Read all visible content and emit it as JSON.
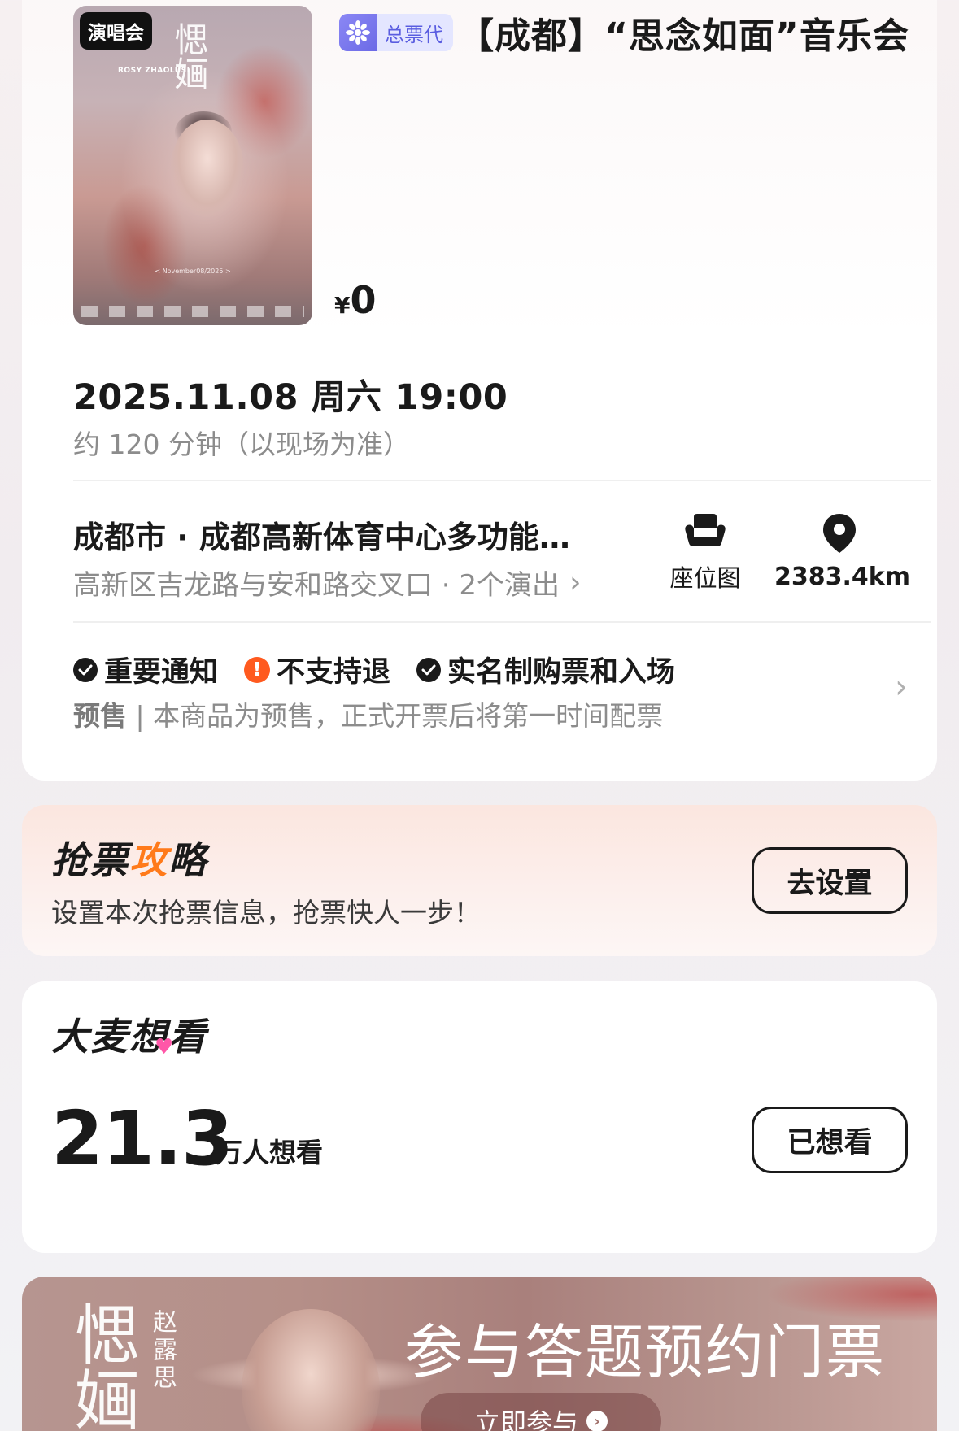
{
  "event": {
    "category_tag": "演唱会",
    "agent_badge": "总票代",
    "title": "【成都】“思念如面”音乐会",
    "price_symbol": "¥",
    "price": "0",
    "datetime": "2025.11.08 周六 19:00",
    "duration": "约 120 分钟（以现场为准）",
    "venue_name": "成都市 · 成都高新体育中心多功能…",
    "venue_address": "高新区吉龙路与安和路交叉口 · 2个演出",
    "seat_map_label": "座位图",
    "distance": "2383.4km",
    "notices": [
      "重要通知",
      "不支持退",
      "实名制购票和入场"
    ],
    "presale_label": "预售",
    "presale_text": "| 本商品为预售，正式开票后将第一时间配票",
    "poster": {
      "callig": "愢婳",
      "small": "ROSY ZHAOLUSI",
      "date": "< November08/2025 >"
    }
  },
  "strategy": {
    "title_a": "抢票",
    "title_bolt": "攻",
    "title_b": "略",
    "description": "设置本次抢票信息，抢票快人一步！",
    "button": "去设置"
  },
  "want": {
    "title": "大麦想看",
    "count": "21.3",
    "unit": "万人想看",
    "button": "已想看"
  },
  "banner": {
    "callig": "愢婳",
    "name": "赵露思",
    "title": "参与答题预约门票",
    "button": "立即参与"
  },
  "colors": {
    "warning": "#ff5a1f",
    "agent_badge": "#5a5de0",
    "heart": "#ff57a8",
    "bolt": "#ff7a1a"
  },
  "icons": {
    "seat_map": "armchair-icon",
    "location": "map-pin-icon",
    "check": "check-circle-icon",
    "warning": "exclamation-circle-icon",
    "chevron": "chevron-right-icon"
  }
}
